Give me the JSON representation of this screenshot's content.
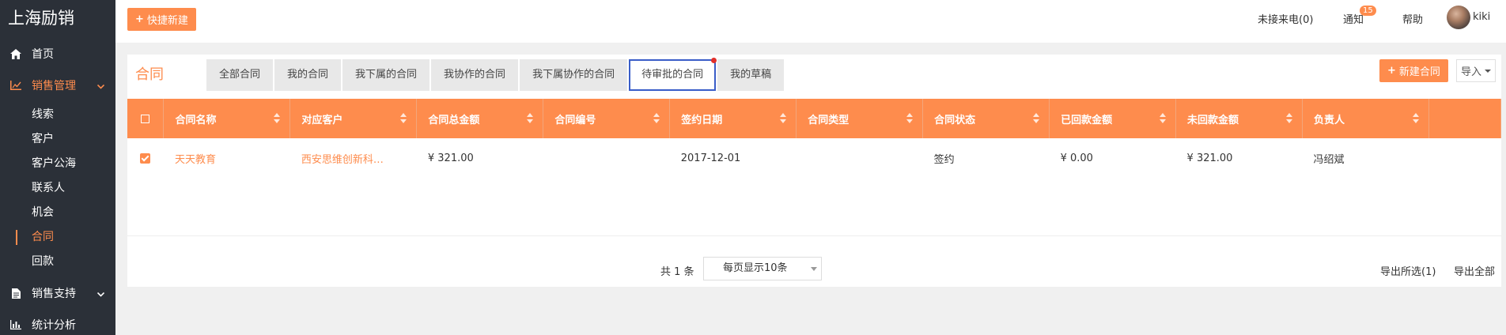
{
  "brand": "上海励销",
  "sidebar": {
    "items": [
      {
        "label": "首页",
        "icon": "home-icon"
      },
      {
        "label": "销售管理",
        "icon": "chart-icon",
        "expanded": true
      },
      {
        "label": "销售支持",
        "icon": "document-icon"
      },
      {
        "label": "统计分析",
        "icon": "bar-chart-icon"
      }
    ],
    "sub_items": [
      "线索",
      "客户",
      "客户公海",
      "联系人",
      "机会",
      "合同",
      "回款"
    ],
    "active_sub": "合同",
    "accent_color": "#fe8c4d"
  },
  "topbar": {
    "quick_new": "快捷新建",
    "missed_calls": "未接来电(0)",
    "notifications": "通知",
    "notification_count": "15",
    "help": "帮助",
    "username": "kiki"
  },
  "page": {
    "title": "合同",
    "tabs": [
      "全部合同",
      "我的合同",
      "我下属的合同",
      "我协作的合同",
      "我下属协作的合同",
      "待审批的合同",
      "我的草稿"
    ],
    "active_tab": "待审批的合同",
    "new_button": "新建合同",
    "import_button": "导入"
  },
  "table": {
    "columns": [
      "合同名称",
      "对应客户",
      "合同总金额",
      "合同编号",
      "签约日期",
      "合同类型",
      "合同状态",
      "已回款金额",
      "未回款金额",
      "负责人"
    ],
    "rows": [
      {
        "checked": true,
        "name": "天天教育",
        "customer": "西安思维创新科…",
        "total": "¥ 321.00",
        "number": "",
        "date": "2017-12-01",
        "type": "",
        "status": "签约",
        "received": "¥ 0.00",
        "unreceived": "¥ 321.00",
        "owner": "冯绍斌"
      }
    ]
  },
  "footer": {
    "total": "共 1 条",
    "page_size": "每页显示10条",
    "export_selected": "导出所选(1)",
    "export_all": "导出全部"
  }
}
